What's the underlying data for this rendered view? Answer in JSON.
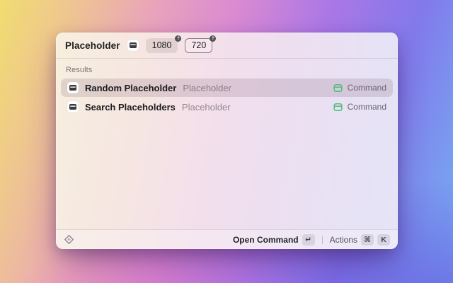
{
  "search": {
    "query": "Placeholder",
    "extension_icon": "placeholder-extension-icon",
    "arguments": [
      {
        "value": "1080",
        "badge": "?",
        "focused": false
      },
      {
        "value": "720",
        "badge": "?",
        "focused": true
      }
    ]
  },
  "results": {
    "section_label": "Results",
    "items": [
      {
        "title": "Random Placeholder",
        "subtitle": "Placeholder",
        "accessory_icon": "command-window-icon",
        "accessory": "Command",
        "selected": true
      },
      {
        "title": "Search Placeholders",
        "subtitle": "Placeholder",
        "accessory_icon": "command-window-icon",
        "accessory": "Command",
        "selected": false
      }
    ]
  },
  "footer": {
    "app_icon": "raycast-logo-icon",
    "primary_action": "Open Command",
    "primary_key": "↵",
    "actions_label": "Actions",
    "actions_keys": [
      "⌘",
      "K"
    ]
  },
  "colors": {
    "accent_green": "#4fbf77",
    "selection_tint": "rgba(98,68,92,0.16)"
  }
}
